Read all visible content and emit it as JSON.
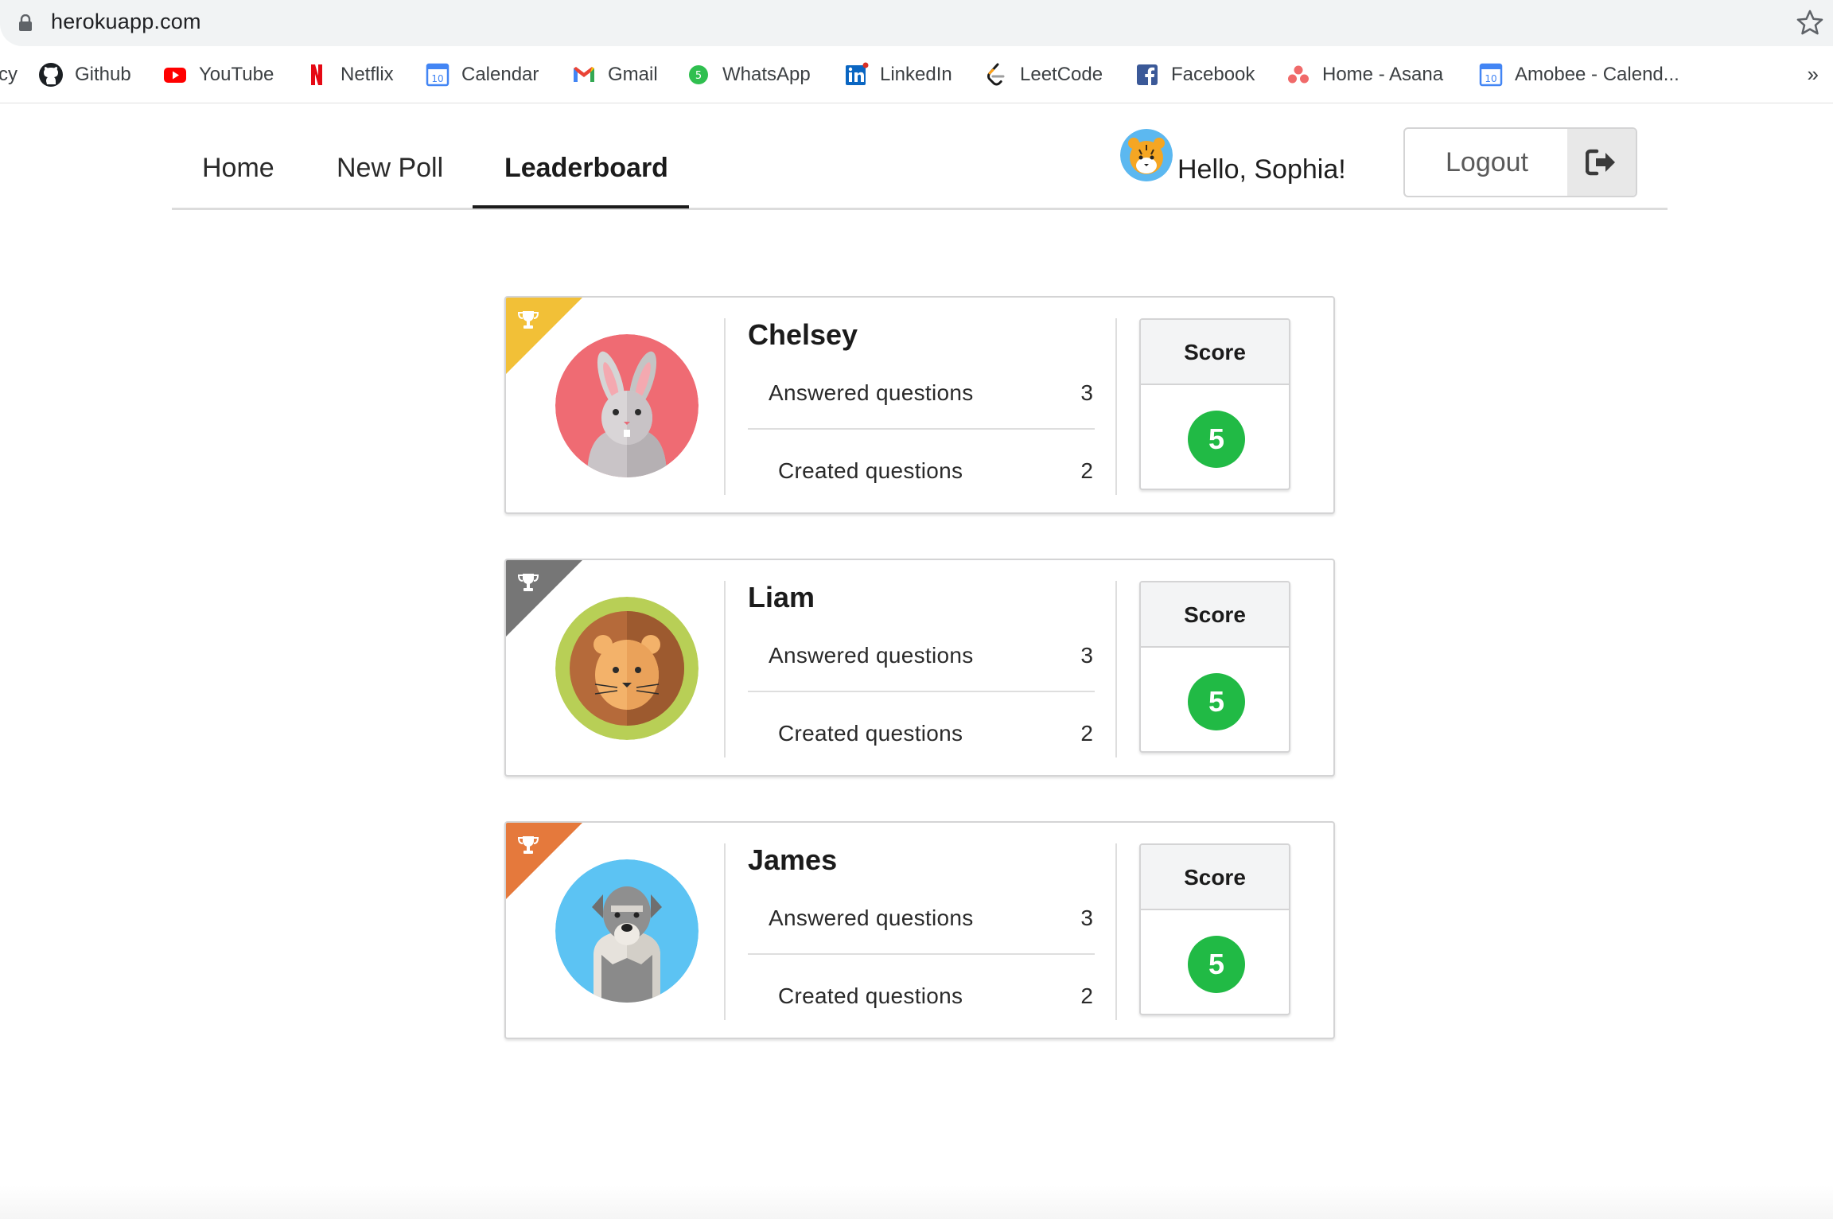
{
  "browser": {
    "url": "herokuapp.com",
    "bookmark_cut": "cy",
    "bookmarks": [
      {
        "label": "Github",
        "icon": "github-icon"
      },
      {
        "label": "YouTube",
        "icon": "youtube-icon"
      },
      {
        "label": "Netflix",
        "icon": "netflix-icon"
      },
      {
        "label": "Calendar",
        "icon": "calendar-icon"
      },
      {
        "label": "Gmail",
        "icon": "gmail-icon"
      },
      {
        "label": "WhatsApp",
        "icon": "whatsapp-icon"
      },
      {
        "label": "LinkedIn",
        "icon": "linkedin-icon"
      },
      {
        "label": "LeetCode",
        "icon": "leetcode-icon"
      },
      {
        "label": "Facebook",
        "icon": "facebook-icon"
      },
      {
        "label": "Home - Asana",
        "icon": "asana-icon"
      },
      {
        "label": "Amobee - Calend...",
        "icon": "calendar-icon"
      }
    ],
    "more": "»",
    "calendar_day": "10",
    "whatsapp_badge": "5"
  },
  "nav": {
    "tabs": [
      {
        "label": "Home"
      },
      {
        "label": "New Poll"
      },
      {
        "label": "Leaderboard",
        "active": true
      }
    ],
    "greeting": "Hello, Sophia!",
    "logout_label": "Logout"
  },
  "leaderboard": {
    "entries": [
      {
        "name": "Chelsey",
        "answered_label": "Answered questions",
        "answered": "3",
        "created_label": "Created questions",
        "created": "2",
        "score_label": "Score",
        "score": "5",
        "rank_color": "#f2c037",
        "avatar": "rabbit-avatar"
      },
      {
        "name": "Liam",
        "answered_label": "Answered questions",
        "answered": "3",
        "created_label": "Created questions",
        "created": "2",
        "score_label": "Score",
        "score": "5",
        "rank_color": "#767676",
        "avatar": "lion-avatar"
      },
      {
        "name": "James",
        "answered_label": "Answered questions",
        "answered": "3",
        "created_label": "Created questions",
        "created": "2",
        "score_label": "Score",
        "score": "5",
        "rank_color": "#e5793c",
        "avatar": "dog-avatar"
      }
    ]
  },
  "colors": {
    "score_green": "#21ba45",
    "gold": "#f2c037",
    "silver": "#767676",
    "bronze": "#e5793c"
  }
}
